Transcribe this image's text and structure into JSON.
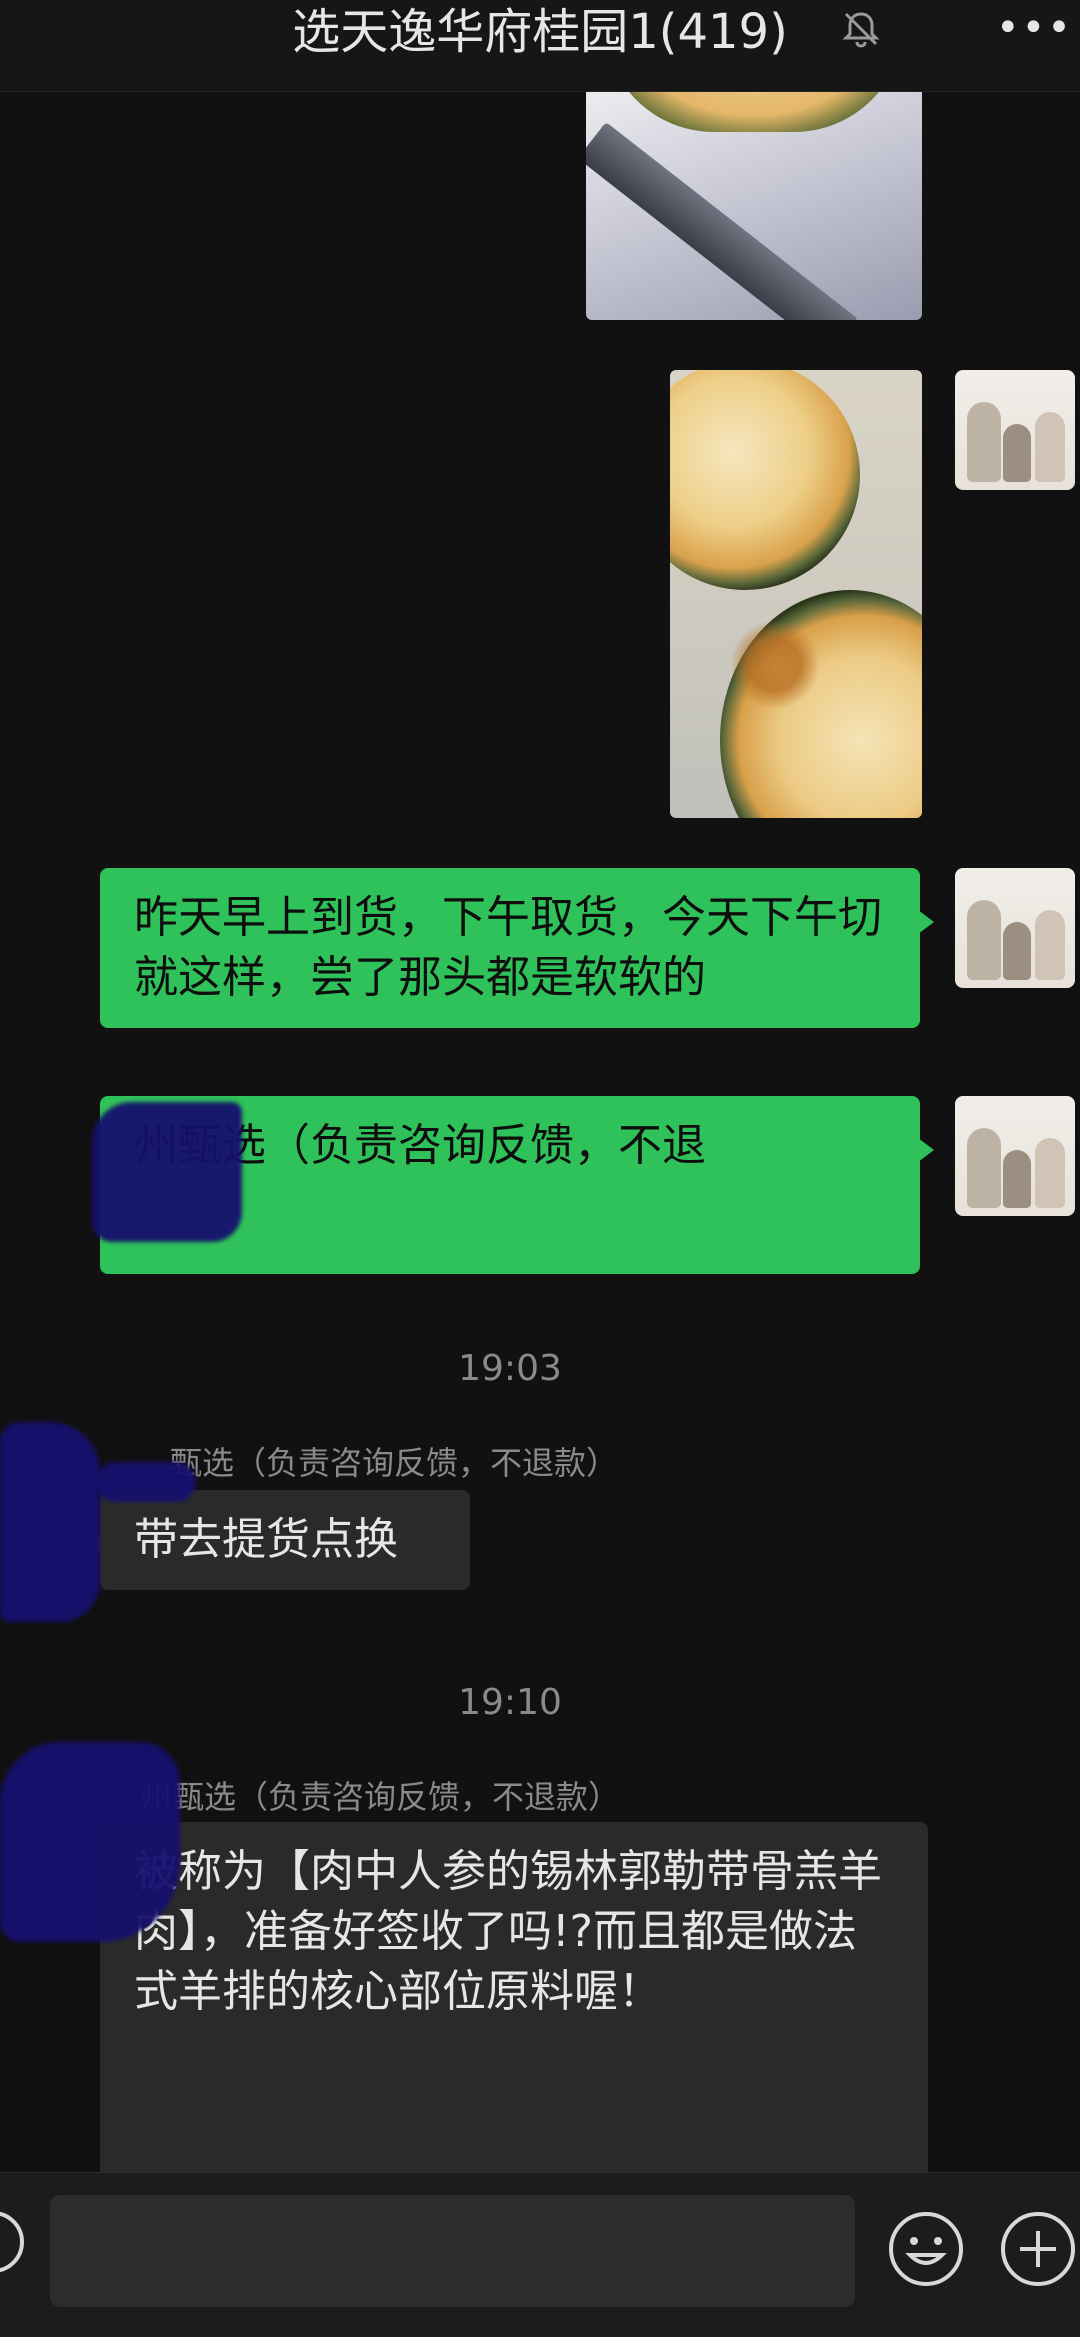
{
  "header": {
    "title": "选天逸华府桂园1(419)",
    "mute_icon": "bell-muted-icon",
    "more_icon": "more-dots-icon",
    "more_label": "•••"
  },
  "messages": {
    "out_1": "昨天早上到货，下午取货，今天下午切就这样，尝了那头都是软软的",
    "out_2": "州甄选（负责咨询反馈，不退"
  },
  "times": {
    "t1": "19:03",
    "t2": "19:10"
  },
  "incoming": {
    "sender_1": "甄选（负责咨询反馈，不退款）",
    "msg_1": "带去提货点换",
    "sender_2": "州甄选（负责咨询反馈，不退款）",
    "msg_2": "被称为【肉中人参的锡林郭勒带骨羔羊肉】，准备好签收了吗!?而且都是做法式羊排的核心部位原料喔！"
  },
  "bottom": {
    "voice_icon": "voice-icon",
    "input_placeholder": "",
    "emoji_icon": "emoji-icon",
    "plus_icon": "plus-icon"
  },
  "colors": {
    "outgoing_bubble": "#30c25a",
    "incoming_bubble": "#2a2a2a",
    "background": "#111111"
  }
}
